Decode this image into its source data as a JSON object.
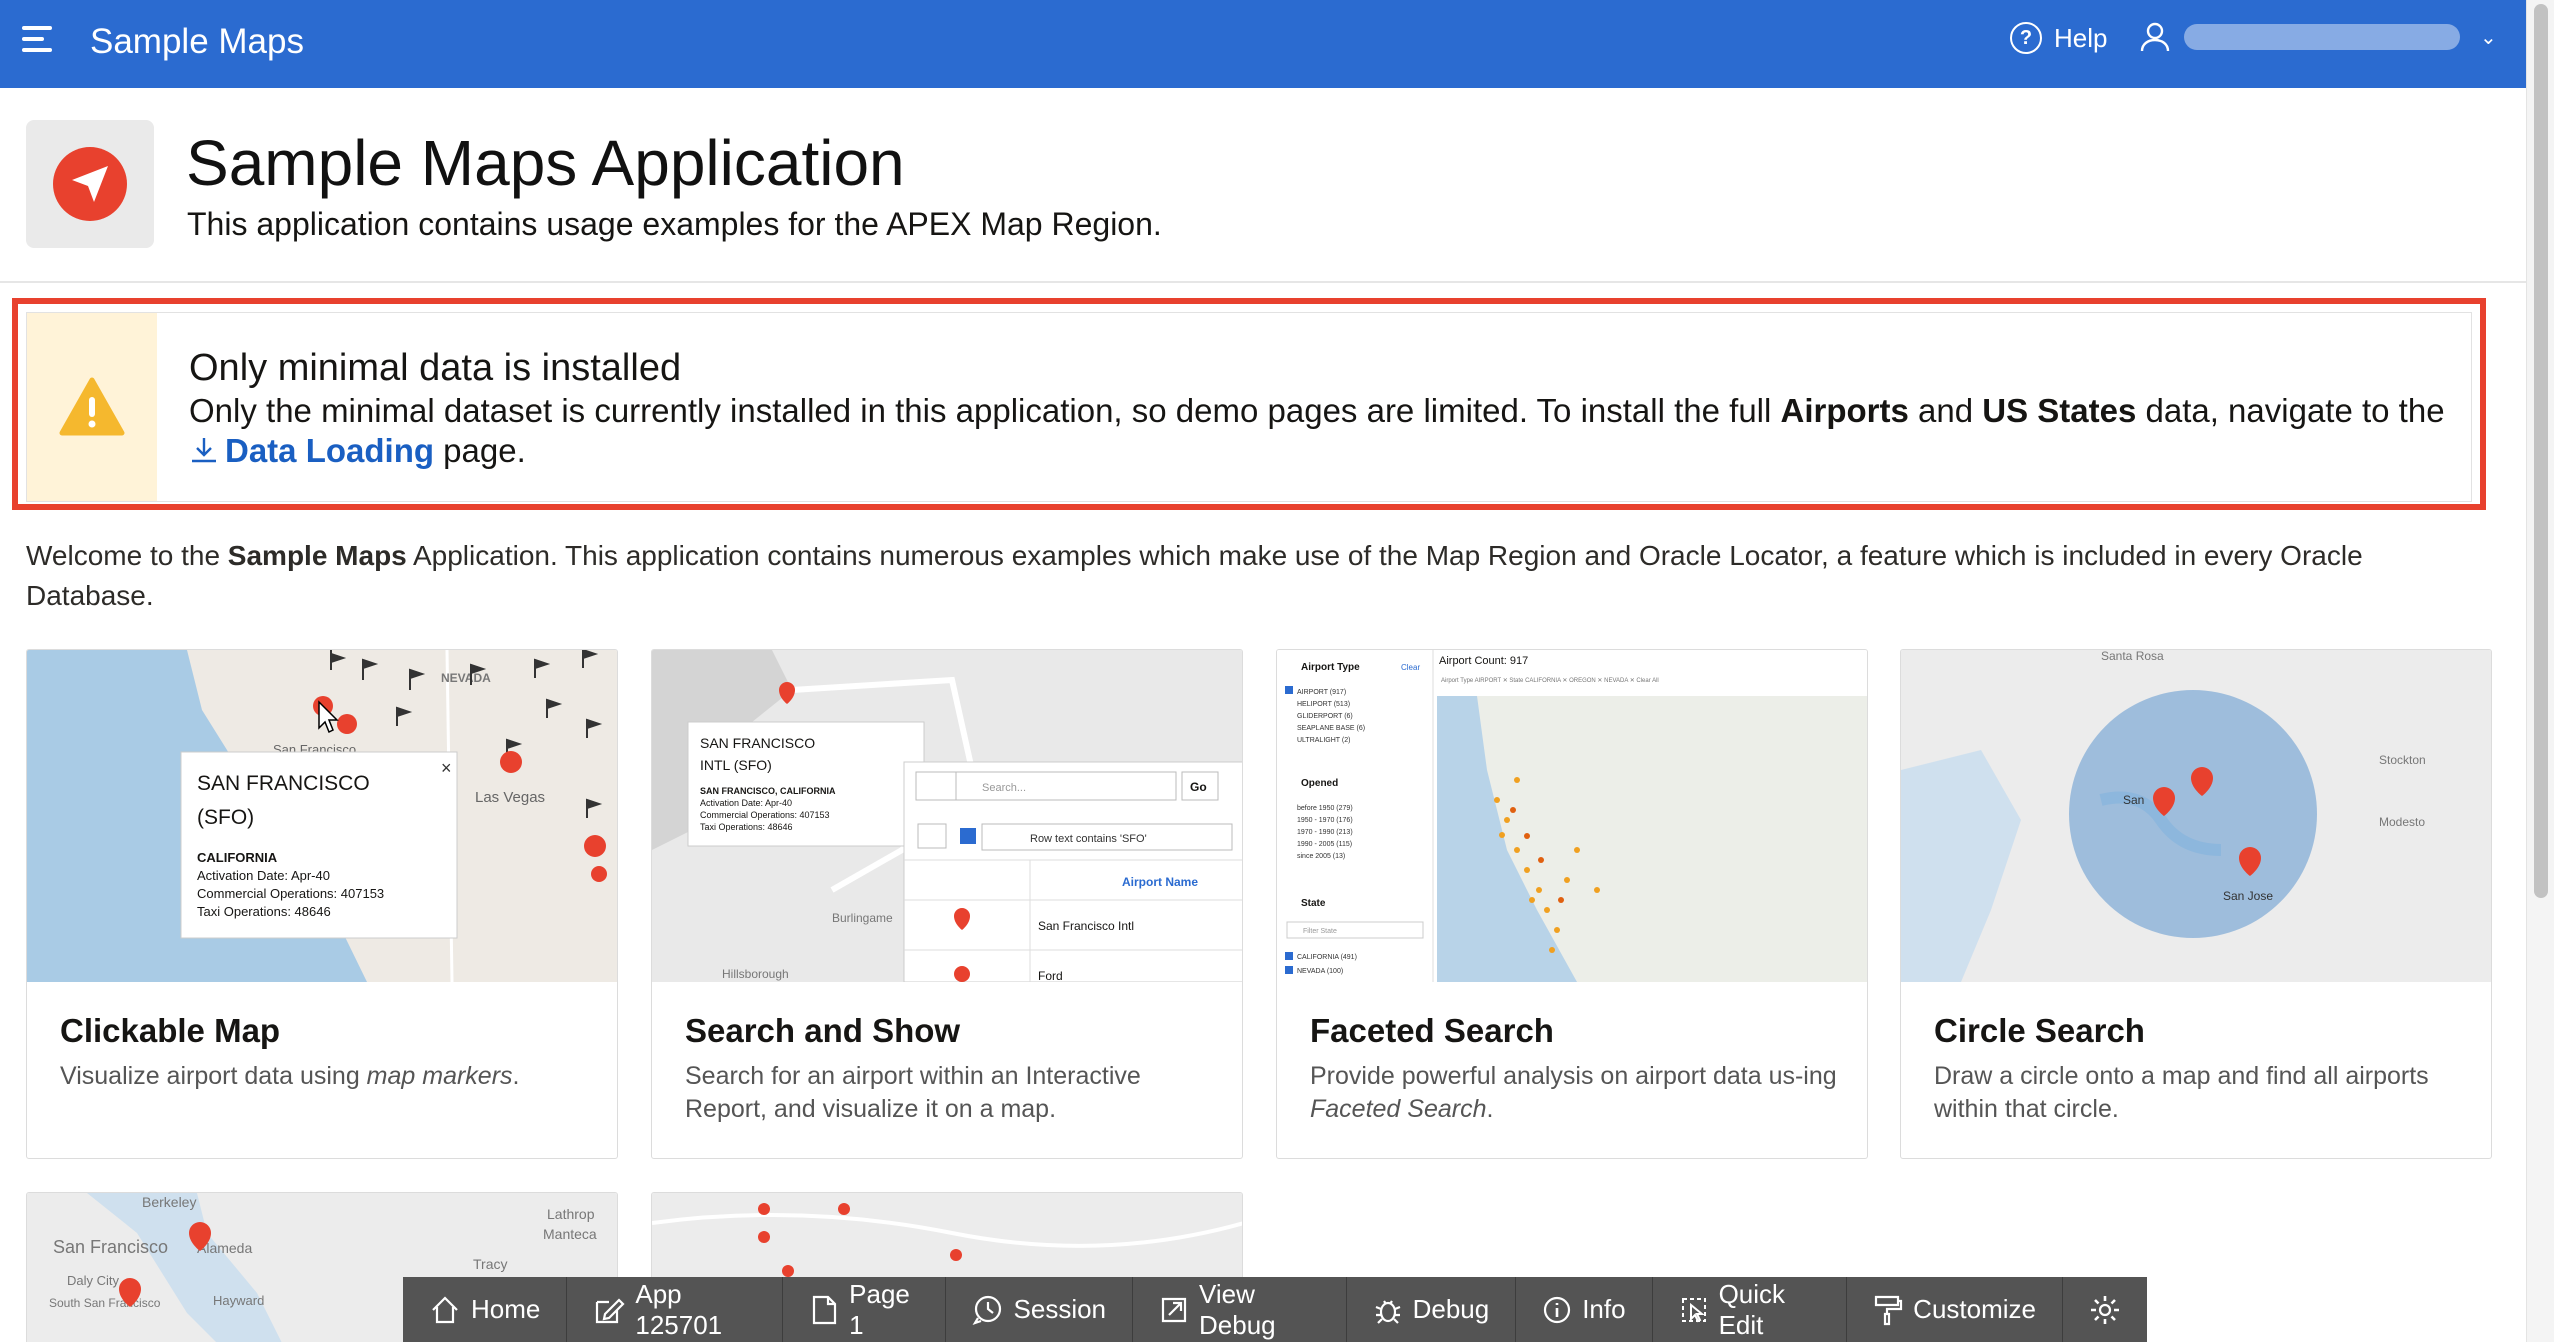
{
  "header": {
    "app_name": "Sample Maps",
    "help_label": "Help"
  },
  "title": {
    "heading": "Sample Maps Application",
    "subheading": "This application contains usage examples for the APEX Map Region."
  },
  "alert": {
    "title": "Only minimal data is installed",
    "body_pre": "Only the minimal dataset is currently installed in this application, so demo pages are limited. To install the full ",
    "airports": "Airports",
    "and": " and ",
    "us_states": "US States",
    "body_mid": " data, navigate to the ",
    "link": "Data Loading",
    "body_post": " page."
  },
  "welcome": {
    "pre": "Welcome to the ",
    "bold": "Sample Maps",
    "post": " Application. This application contains numerous examples which make use of the Map Region and Oracle Locator, a feature which is included in every Oracle Database."
  },
  "cards": [
    {
      "title": "Clickable Map",
      "desc_pre": "Visualize airport data using ",
      "desc_em": "map markers",
      "desc_post": "."
    },
    {
      "title": "Search and Show",
      "desc": "Search for an airport within an Interactive Report, and visualize it on a map."
    },
    {
      "title": "Faceted Search",
      "desc_pre": "Provide powerful analysis on airport data us-ing ",
      "desc_em": "Faceted Search",
      "desc_post": "."
    },
    {
      "title": "Circle Search",
      "desc": "Draw a circle onto a map and find all airports within that circle."
    }
  ],
  "thumb_clickable": {
    "state": "NEVADA",
    "city": "San Francisco",
    "city2": "Las Vegas",
    "popup_title1": "SAN FRANCISCO",
    "popup_title2": "(SFO)",
    "popup_state": "CALIFORNIA",
    "popup_l1": "Activation Date: Apr-40",
    "popup_l2": "Commercial Operations: 407153",
    "popup_l3": "Taxi Operations: 48646"
  },
  "thumb_search": {
    "pop1": "SAN FRANCISCO",
    "pop2": "INTL (SFO)",
    "pop3": "SAN FRANCISCO, CALIFORNIA",
    "pop4": "Activation Date: Apr-40",
    "pop5": "Commercial Operations: 407153",
    "pop6": "Taxi Operations: 48646",
    "search_ph": "Search...",
    "go": "Go",
    "filter": "Row text contains 'SFO'",
    "col": "Airport Name",
    "r1": "San Francisco Intl",
    "r2": "Ford",
    "city1": "Burlingame",
    "city2": "Hillsborough"
  },
  "thumb_faceted": {
    "facet1": "Airport Type",
    "clear": "Clear",
    "f1": [
      "AIRPORT (917)",
      "HELIPORT (513)",
      "GLIDERPORT (6)",
      "SEAPLANE BASE (6)",
      "ULTRALIGHT (2)"
    ],
    "facet2": "Opened",
    "f2": [
      "before 1950 (279)",
      "1950 - 1970 (176)",
      "1970 - 1990 (213)",
      "1990 - 2005 (115)",
      "since 2005 (13)"
    ],
    "facet3": "State",
    "filter_state": "Filter State",
    "f3": [
      "CALIFORNIA (491)",
      "NEVADA (100)"
    ],
    "count": "Airport Count: 917",
    "chips": "Airport Type  AIRPORT ✕   State  CALIFORNIA ✕  OREGON ✕  NEVADA ✕   Clear All"
  },
  "thumb_circle": {
    "l1": "Santa Rosa",
    "l2": "Stockton",
    "l3": "Modesto",
    "l4": "San Jose",
    "l5": "San"
  },
  "thumb_row2": {
    "l1": "Berkeley",
    "l2": "San Francisco",
    "l3": "Alameda",
    "l4": "Lathrop",
    "l5": "Manteca",
    "l6": "Tracy",
    "l7": "Daly City",
    "l8": "Hayward",
    "l9": "South San Francisco"
  },
  "devbar": [
    "Home",
    "App 125701",
    "Page 1",
    "Session",
    "View Debug",
    "Debug",
    "Info",
    "Quick Edit",
    "Customize"
  ]
}
